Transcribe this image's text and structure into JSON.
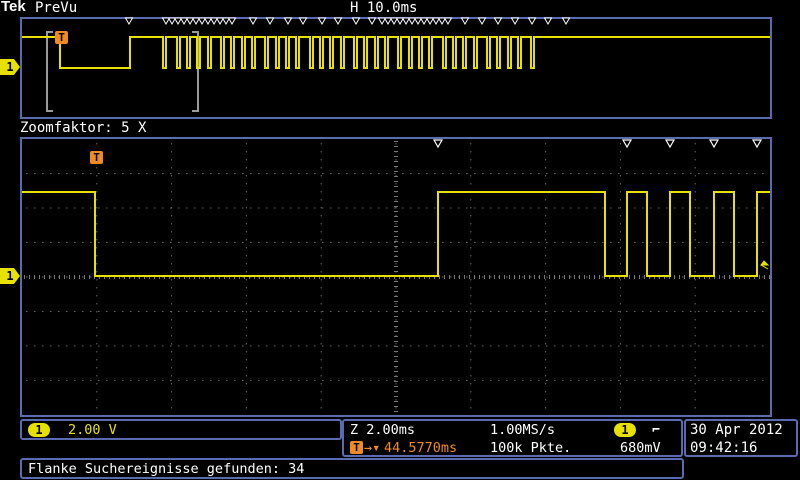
{
  "header": {
    "brand": "Tek",
    "mode": "PreVu",
    "horizontal_scale": "H 10.0ms"
  },
  "zoom": {
    "label": "Zoomfaktor: 5 X"
  },
  "channel": {
    "number": "1",
    "scale": "2.00 V",
    "color": "#e8e000"
  },
  "trigger_marker": "T",
  "timebase": {
    "zoom_scale": "Z 2.00ms",
    "sample_rate": "1.00MS/s",
    "position": "44.5770ms",
    "record_length": "100k Pkte.",
    "trigger_channel": "1",
    "trigger_slope_icon": "falling-edge-icon",
    "trigger_slope_glyph": "⌐",
    "trigger_level": "680mV"
  },
  "datetime": {
    "date": "30 Apr 2012",
    "time": "09:42:16"
  },
  "status_message": "Flanke Suchereignisse gefunden: 34",
  "colors": {
    "trace": "#e8e000",
    "accent": "#f08a24",
    "frame": "#5b6bb0"
  }
}
